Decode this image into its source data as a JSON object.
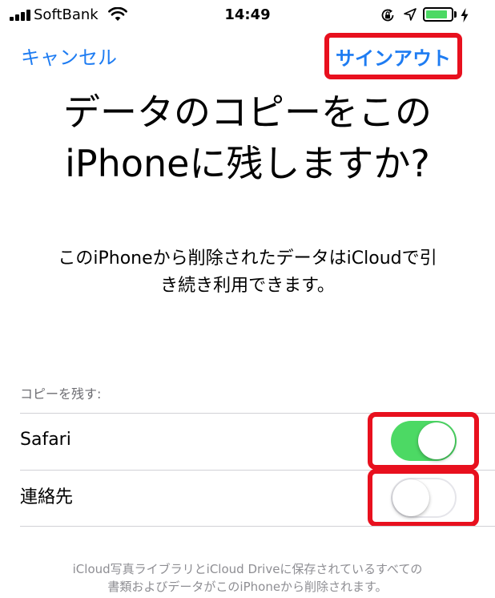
{
  "status_bar": {
    "carrier": "SoftBank",
    "time": "14:49",
    "battery_fill_fraction": 0.85,
    "battery_color": "#4cd964",
    "icons": [
      "signal-icon",
      "wifi-icon",
      "rotation-lock-icon",
      "location-arrow-icon",
      "battery-icon",
      "charging-bolt-icon"
    ]
  },
  "nav": {
    "cancel_label": "キャンセル",
    "sign_out_label": "サインアウト",
    "accent_color": "#1e7cf2",
    "highlight_color": "#e8101e"
  },
  "title": {
    "line1": "データのコピーをこの",
    "line2": "iPhoneに残しますか?"
  },
  "description": {
    "line1": "このiPhoneから削除されたデータはiCloudで引",
    "line2": "き続き利用できます。"
  },
  "copy_section": {
    "header": "コピーを残す:",
    "items": [
      {
        "label": "Safari",
        "on": true
      },
      {
        "label": "連絡先",
        "on": false
      }
    ]
  },
  "footer": {
    "line1": "iCloud写真ライブラリとiCloud Driveに保存されているすべての",
    "line2": "書類およびデータがこのiPhoneから削除されます。"
  }
}
